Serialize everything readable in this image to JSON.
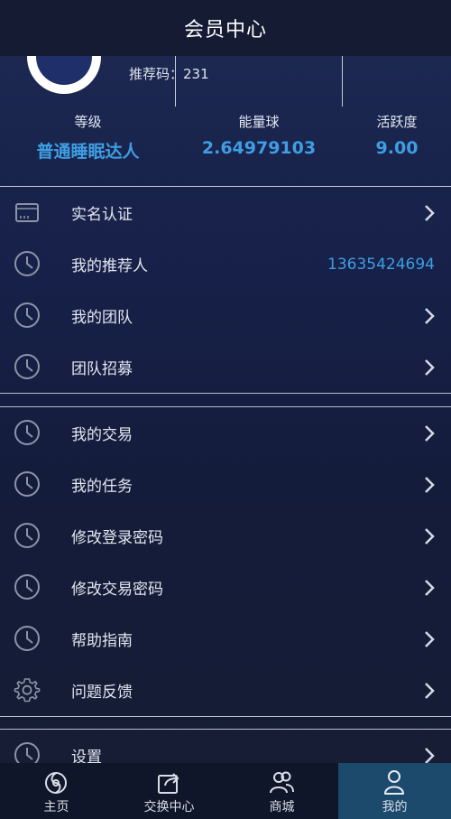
{
  "header": {
    "title": "会员中心"
  },
  "profile": {
    "referral_label": "推荐码：",
    "referral_code": "231"
  },
  "stats": [
    {
      "label": "等级",
      "value": "普通睡眠达人"
    },
    {
      "label": "能量球",
      "value": "2.64979103"
    },
    {
      "label": "活跃度",
      "value": "9.00"
    }
  ],
  "menu_section_1": [
    {
      "label": "实名认证",
      "icon": "id-card-icon"
    },
    {
      "label": "我的推荐人",
      "icon": "clock-icon",
      "value": "13635424694"
    },
    {
      "label": "我的团队",
      "icon": "clock-icon"
    },
    {
      "label": "团队招募",
      "icon": "clock-icon"
    }
  ],
  "menu_section_2": [
    {
      "label": "我的交易",
      "icon": "clock-icon"
    },
    {
      "label": "我的任务",
      "icon": "clock-icon"
    },
    {
      "label": "修改登录密码",
      "icon": "clock-icon"
    },
    {
      "label": "修改交易密码",
      "icon": "clock-icon"
    },
    {
      "label": "帮助指南",
      "icon": "clock-icon"
    },
    {
      "label": "问题反馈",
      "icon": "gear-icon"
    }
  ],
  "menu_section_3": [
    {
      "label": "设置",
      "icon": "clock-icon"
    }
  ],
  "tabbar": [
    {
      "label": "主页",
      "icon": "home-swirl-icon",
      "active": false
    },
    {
      "label": "交换中心",
      "icon": "share-icon",
      "active": false
    },
    {
      "label": "商城",
      "icon": "users-icon",
      "active": false
    },
    {
      "label": "我的",
      "icon": "user-icon",
      "active": true
    }
  ],
  "colors": {
    "accent": "#3f9ee3",
    "header_bg": "#141b33",
    "tab_active_bg": "#1c4a6c"
  }
}
